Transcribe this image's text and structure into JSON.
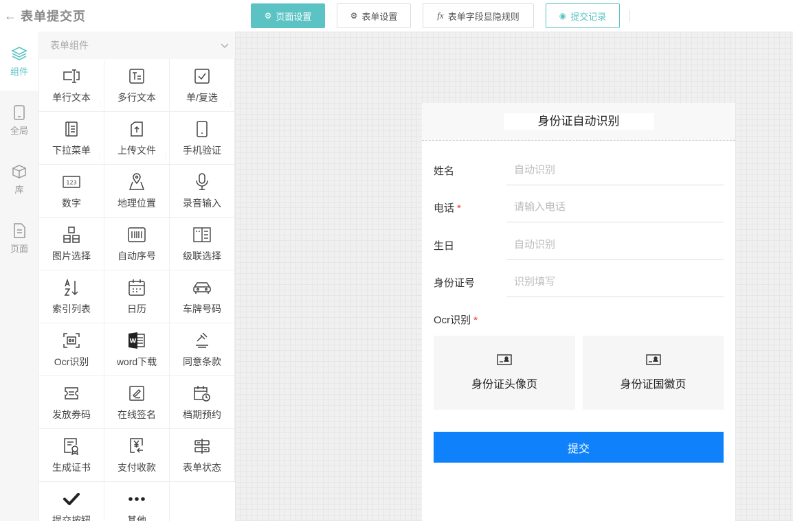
{
  "header": {
    "back_icon": "arrow-left-icon",
    "title": "表单提交页"
  },
  "toolbar": {
    "page_settings": "页面设置",
    "form_settings": "表单设置",
    "field_rules": "表单字段显隐规则",
    "submit_records": "提交记录"
  },
  "nav": [
    {
      "label": "组件",
      "icon": "layers-icon",
      "active": true
    },
    {
      "label": "全局",
      "icon": "tablet-icon"
    },
    {
      "label": "库",
      "icon": "box-icon"
    },
    {
      "label": "页面",
      "icon": "document-icon"
    }
  ],
  "panel": {
    "title": "表单组件",
    "items": [
      {
        "label": "单行文本",
        "icon": "text-input-icon"
      },
      {
        "label": "多行文本",
        "icon": "textarea-icon"
      },
      {
        "label": "单/复选",
        "icon": "checkbox-icon"
      },
      {
        "label": "下拉菜单",
        "icon": "dropdown-list-icon"
      },
      {
        "label": "上传文件",
        "icon": "upload-icon"
      },
      {
        "label": "手机验证",
        "icon": "phone-icon"
      },
      {
        "label": "数字",
        "icon": "number-icon"
      },
      {
        "label": "地理位置",
        "icon": "location-icon"
      },
      {
        "label": "录音输入",
        "icon": "microphone-icon"
      },
      {
        "label": "图片选择",
        "icon": "image-select-icon"
      },
      {
        "label": "自动序号",
        "icon": "barcode-icon"
      },
      {
        "label": "级联选择",
        "icon": "cascade-icon"
      },
      {
        "label": "索引列表",
        "icon": "sort-az-icon"
      },
      {
        "label": "日历",
        "icon": "calendar-icon"
      },
      {
        "label": "车牌号码",
        "icon": "car-icon"
      },
      {
        "label": "Ocr识别",
        "icon": "scan-id-icon"
      },
      {
        "label": "word下载",
        "icon": "word-icon"
      },
      {
        "label": "同意条款",
        "icon": "gavel-icon"
      },
      {
        "label": "发放券码",
        "icon": "coupon-icon"
      },
      {
        "label": "在线签名",
        "icon": "signature-icon"
      },
      {
        "label": "档期预约",
        "icon": "schedule-icon"
      },
      {
        "label": "生成证书",
        "icon": "certificate-icon"
      },
      {
        "label": "支付收款",
        "icon": "payment-icon"
      },
      {
        "label": "表单状态",
        "icon": "status-icon"
      },
      {
        "label": "提交按钮",
        "icon": "check-icon"
      },
      {
        "label": "其他",
        "icon": "more-icon"
      }
    ]
  },
  "form": {
    "title": "身份证自动识别",
    "fields": [
      {
        "label": "姓名",
        "placeholder": "自动识别",
        "required": false
      },
      {
        "label": "电话",
        "placeholder": "请输入电话",
        "required": true
      },
      {
        "label": "生日",
        "placeholder": "自动识别",
        "required": false
      },
      {
        "label": "身份证号",
        "placeholder": "识别填写",
        "required": false
      }
    ],
    "ocr": {
      "label": "Ocr识别",
      "required": true,
      "front": "身份证头像页",
      "back": "身份证国徽页"
    },
    "submit": "提交",
    "required_mark": "*"
  },
  "colors": {
    "accent": "#5bc3c4",
    "submit": "#0f82fb",
    "required": "#e33333"
  }
}
